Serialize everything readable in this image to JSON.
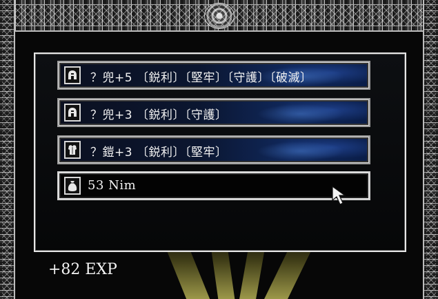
{
  "loot": {
    "items": [
      {
        "icon": "helmet-icon",
        "label": "？兜+5 〔鋭利〕〔堅牢〕〔守護〕〔破滅〕"
      },
      {
        "icon": "helmet-icon",
        "label": "？兜+3 〔鋭利〕〔守護〕"
      },
      {
        "icon": "armor-icon",
        "label": "？鎧+3 〔鋭利〕〔堅牢〕"
      },
      {
        "icon": "money-bag-icon",
        "label": "53 Nim"
      }
    ],
    "selected_index": 3
  },
  "reward": {
    "exp_text": "+82 EXP"
  },
  "colors": {
    "frame": "#bdbdbd",
    "item_blue": "#10285c",
    "ray": "#bebe5a"
  }
}
